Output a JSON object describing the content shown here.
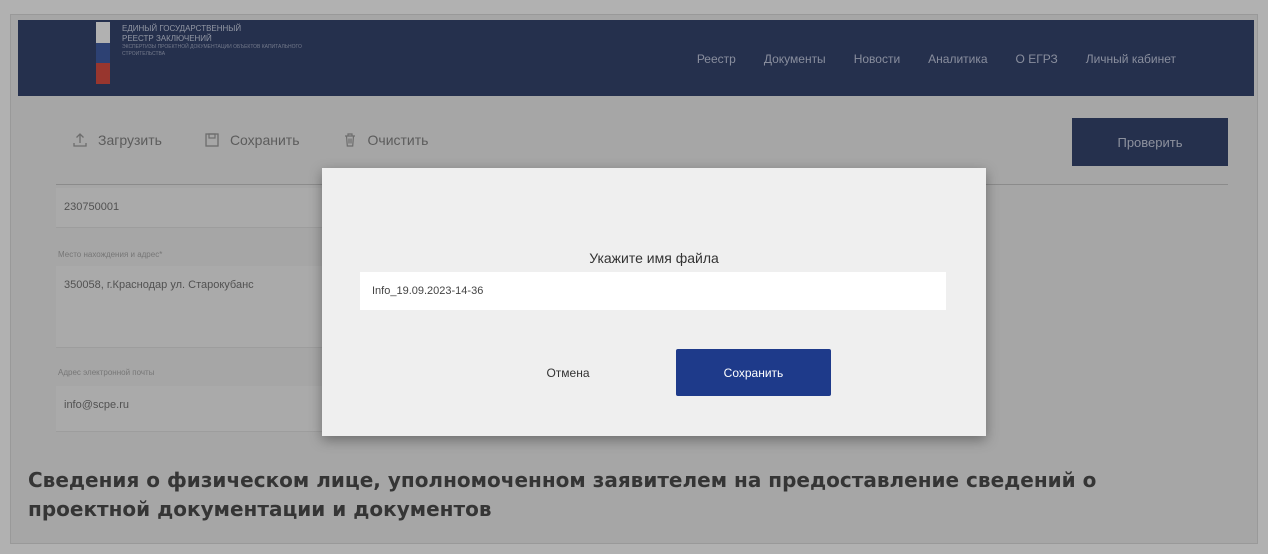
{
  "header": {
    "logo_lines": [
      "ЕДИНЫЙ ГОСУДАРСТВЕННЫЙ",
      "РЕЕСТР ЗАКЛЮЧЕНИЙ",
      "ЭКСПЕРТИЗЫ ПРОЕКТНОЙ ДОКУМЕНТАЦИИ ОБЪЕКТОВ КАПИТАЛЬНОГО СТРОИТЕЛЬСТВА"
    ],
    "flag_colors": [
      "#ffffff",
      "#1c3f94",
      "#d52b1e"
    ],
    "nav": [
      "Реестр",
      "Документы",
      "Новости",
      "Аналитика",
      "О ЕГРЗ",
      "Личный кабинет"
    ]
  },
  "toolbar": {
    "upload_label": "Загрузить",
    "save_label": "Сохранить",
    "clear_label": "Очистить",
    "check_label": "Проверить"
  },
  "form": {
    "kpp_value": "230750001",
    "address_label": "Место нахождения и адрес*",
    "address_value": "350058, г.Краснодар ул. Старокубанс",
    "email_label": "Адрес электронной почты",
    "email_value": "info@scpe.ru"
  },
  "section_title": "Сведения о физическом лице, уполномоченном заявителем на предоставление сведений о проектной документации и документов",
  "modal": {
    "title": "Укажите имя файла",
    "filename_value": "Info_19.09.2023-14-36",
    "cancel_label": "Отмена",
    "save_label": "Сохранить"
  },
  "colors": {
    "header_bg": "#0f2154",
    "primary_button": "#1e3a8a"
  }
}
